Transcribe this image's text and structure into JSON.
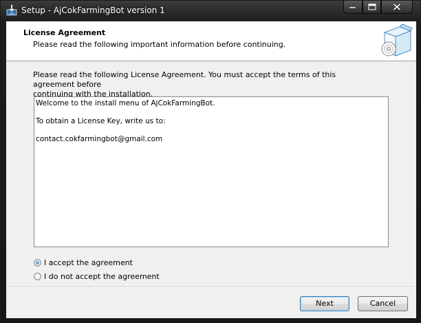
{
  "window": {
    "title": "Setup - AjCokFarmingBot version 1"
  },
  "header": {
    "title": "License Agreement",
    "subtitle": "Please read the following important information before continuing."
  },
  "instructions": {
    "line1": "Please read the following License Agreement. You must accept the terms of this agreement before",
    "line2": "continuing with the installation."
  },
  "license": {
    "lines": [
      "Welcome to the install menu of AjCokFarmingBot.",
      "",
      "To obtain a License Key, write us to:",
      "",
      "contact.cokfarmingbot@gmail.com"
    ]
  },
  "options": {
    "accept_label": "I accept the agreement",
    "decline_label": "I do not accept the agreement",
    "selected": "accept"
  },
  "buttons": {
    "next_label": "Next",
    "cancel_label": "Cancel"
  },
  "icons": {
    "app": "installer-icon",
    "header": "software-box-icon"
  }
}
